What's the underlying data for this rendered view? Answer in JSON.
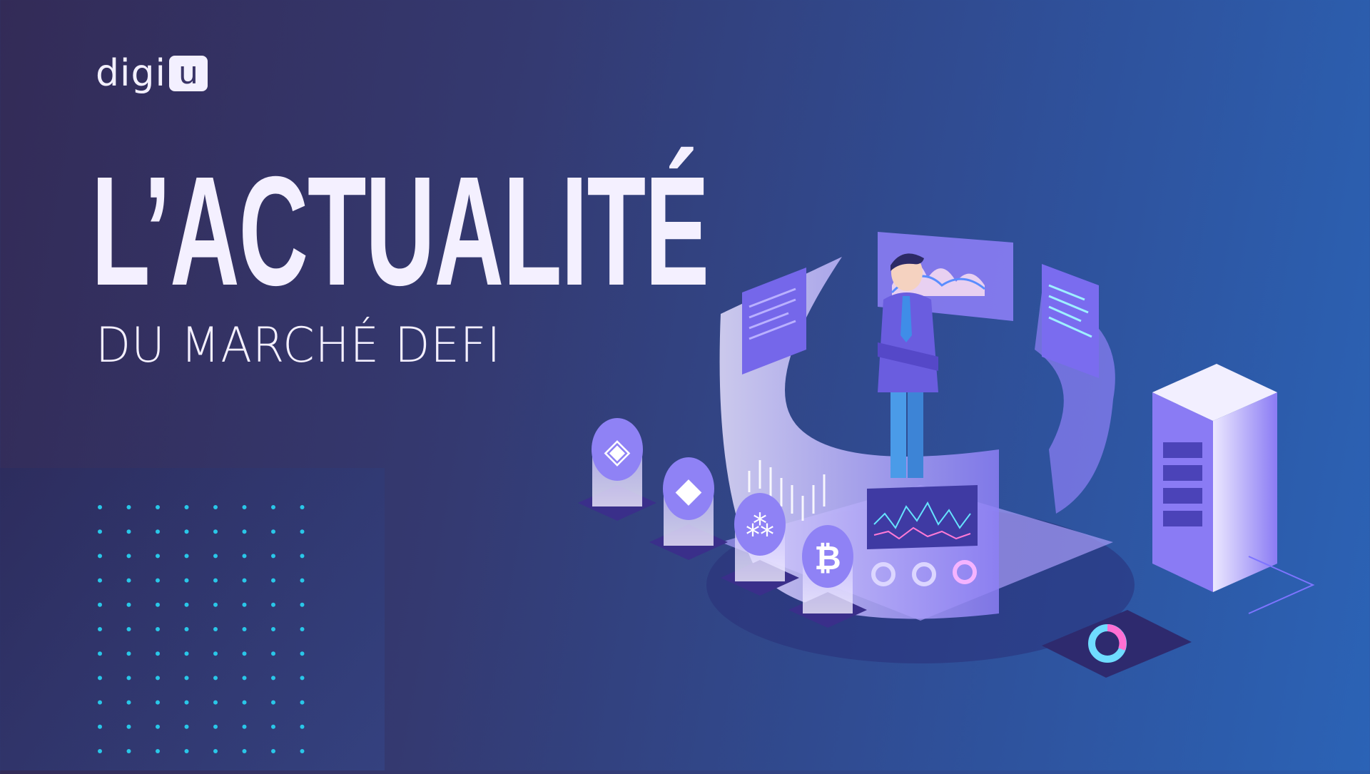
{
  "logo": {
    "text": "digi",
    "badge": "u"
  },
  "headline": {
    "title": "L’ACTUALITÉ",
    "subtitle": "DU MARCHÉ DEFI"
  },
  "colors": {
    "background_start": "#332b57",
    "background_end": "#2b63b6",
    "text": "#f4f0ff",
    "accent_dots": "#29c7e8",
    "illustration": "#7b6cf0"
  },
  "illustration": {
    "icons": [
      "binance-icon",
      "ethereum-icon",
      "iota-icon",
      "bitcoin-icon"
    ],
    "bitcoin_glyph": "₿"
  }
}
